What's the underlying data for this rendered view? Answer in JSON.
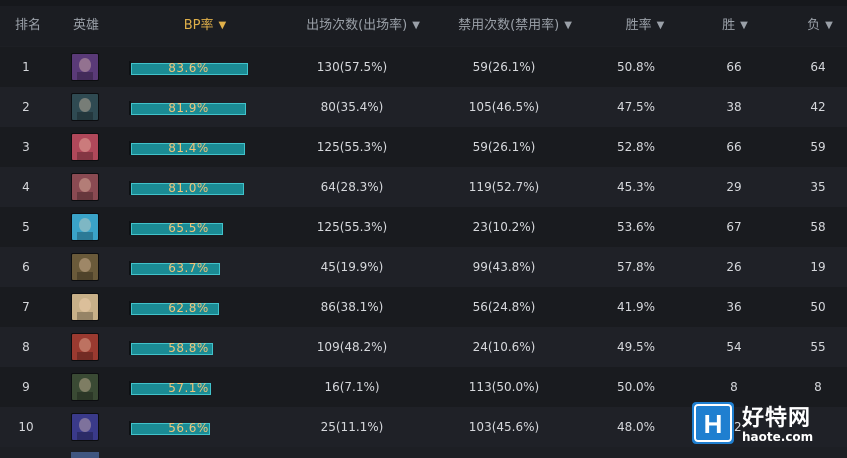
{
  "header": {
    "rank": "排名",
    "hero": "英雄",
    "bp_rate": "BP率",
    "picks": "出场次数(出场率)",
    "bans": "禁用次数(禁用率)",
    "win_rate": "胜率",
    "wins": "胜",
    "losses": "负"
  },
  "sort_column": "bp_rate",
  "colors": {
    "accent": "#e0b04a",
    "bar_fill": "#1b8b94",
    "bar_border": "#41c3cb",
    "logo_blue": "#1f7fd0"
  },
  "rows": [
    {
      "rank": "1",
      "bp": "83.6%",
      "bp_value": 83.6,
      "picks": "130(57.5%)",
      "bans": "59(26.1%)",
      "win_rate": "50.8%",
      "wins": "66",
      "losses": "64",
      "avatar_color": "#5a3a78"
    },
    {
      "rank": "2",
      "bp": "81.9%",
      "bp_value": 81.9,
      "picks": "80(35.4%)",
      "bans": "105(46.5%)",
      "win_rate": "47.5%",
      "wins": "38",
      "losses": "42",
      "avatar_color": "#2f4a52"
    },
    {
      "rank": "3",
      "bp": "81.4%",
      "bp_value": 81.4,
      "picks": "125(55.3%)",
      "bans": "59(26.1%)",
      "win_rate": "52.8%",
      "wins": "66",
      "losses": "59",
      "avatar_color": "#b0485a"
    },
    {
      "rank": "4",
      "bp": "81.0%",
      "bp_value": 81.0,
      "picks": "64(28.3%)",
      "bans": "119(52.7%)",
      "win_rate": "45.3%",
      "wins": "29",
      "losses": "35",
      "avatar_color": "#8a4a52"
    },
    {
      "rank": "5",
      "bp": "65.5%",
      "bp_value": 65.5,
      "picks": "125(55.3%)",
      "bans": "23(10.2%)",
      "win_rate": "53.6%",
      "wins": "67",
      "losses": "58",
      "avatar_color": "#3aa3c8"
    },
    {
      "rank": "6",
      "bp": "63.7%",
      "bp_value": 63.7,
      "picks": "45(19.9%)",
      "bans": "99(43.8%)",
      "win_rate": "57.8%",
      "wins": "26",
      "losses": "19",
      "avatar_color": "#6a5a3a"
    },
    {
      "rank": "7",
      "bp": "62.8%",
      "bp_value": 62.8,
      "picks": "86(38.1%)",
      "bans": "56(24.8%)",
      "win_rate": "41.9%",
      "wins": "36",
      "losses": "50",
      "avatar_color": "#c8b088"
    },
    {
      "rank": "8",
      "bp": "58.8%",
      "bp_value": 58.8,
      "picks": "109(48.2%)",
      "bans": "24(10.6%)",
      "win_rate": "49.5%",
      "wins": "54",
      "losses": "55",
      "avatar_color": "#9a3a30"
    },
    {
      "rank": "9",
      "bp": "57.1%",
      "bp_value": 57.1,
      "picks": "16(7.1%)",
      "bans": "113(50.0%)",
      "win_rate": "50.0%",
      "wins": "8",
      "losses": "8",
      "avatar_color": "#3a4a34"
    },
    {
      "rank": "10",
      "bp": "56.6%",
      "bp_value": 56.6,
      "picks": "25(11.1%)",
      "bans": "103(45.6%)",
      "win_rate": "48.0%",
      "wins": "12",
      "losses": "",
      "avatar_color": "#3a3a8a"
    }
  ],
  "watermark": {
    "title": "好特网",
    "subtitle": "haote.com",
    "icon_letter": "H"
  }
}
